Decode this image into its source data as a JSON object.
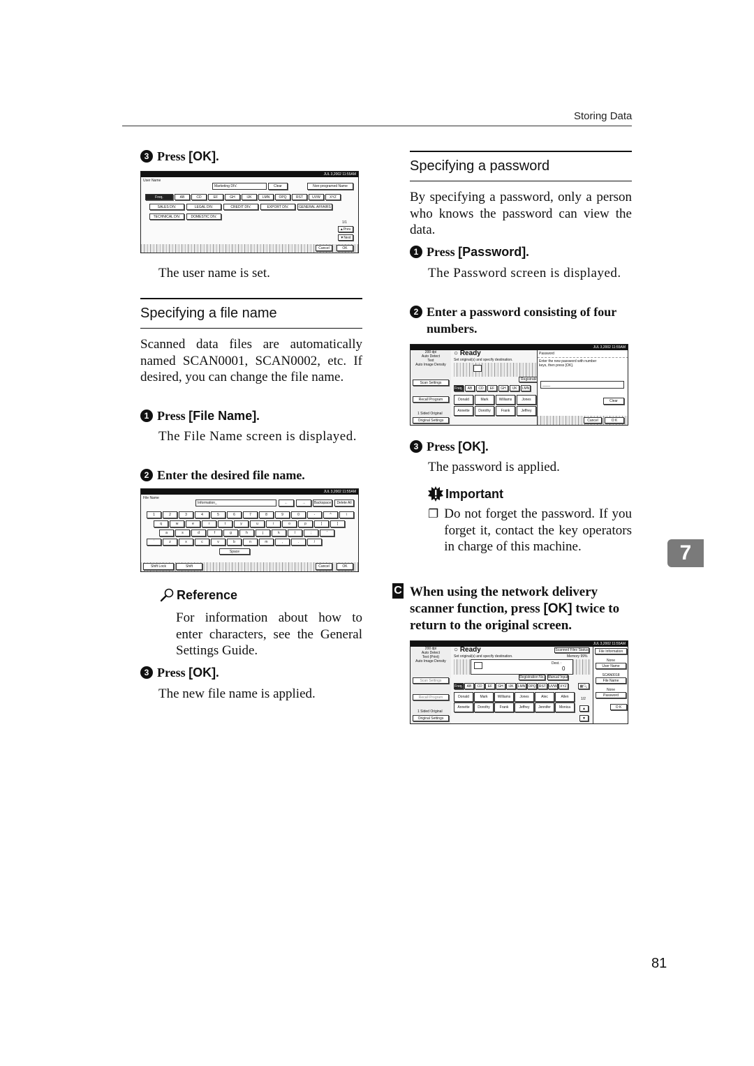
{
  "header": {
    "title": "Storing Data"
  },
  "left": {
    "step3a": {
      "num": "3",
      "prefix": "Press ",
      "key": "[OK]",
      "suffix": "."
    },
    "username_screen": {
      "datetime": "JUL   3,2002 11:55AM",
      "label": "User Name",
      "value": "Marketing DIV.",
      "clear": "Clear",
      "nonprog": "Non-programed Name",
      "tabs": [
        "Freq.",
        "AB",
        "CD",
        "EF",
        "GH",
        "IJK",
        "LMN",
        "OPQ",
        "RST",
        "UVW",
        "XYZ"
      ],
      "entries": [
        "SALES DIV.",
        "LEGAL DIV.",
        "CREDIT DIV.",
        "EXPORT DIV.",
        "GENERAL AFFAIRS",
        "TECHNICAL DIV.",
        "DOMESTIC DIV."
      ],
      "page": "1/1",
      "prev": "▲Prev.",
      "next": "▼Next",
      "cancel": "Cancel",
      "ok": "OK"
    },
    "username_result": "The user name is set.",
    "section_title": "Specifying a file name",
    "intro": "Scanned data files are automatically named SCAN0001, SCAN0002, etc. If desired, you can change the file name.",
    "step1": {
      "num": "1",
      "prefix": "Press ",
      "key": "[File Name]",
      "suffix": "."
    },
    "step1_result": "The File Name screen is displayed.",
    "step2": {
      "num": "2",
      "text": "Enter the desired file name."
    },
    "filename_screen": {
      "datetime": "JUL   3,2002 11:55AM",
      "label": "File Name",
      "value": "Information_",
      "left_arrow": "←",
      "right_arrow": "→",
      "backspace": "Backspace",
      "delete_all": "Delete All",
      "row1": [
        "1",
        "2",
        "3",
        "4",
        "5",
        "6",
        "7",
        "8",
        "9",
        "0",
        "-",
        "^",
        "\\"
      ],
      "row2": [
        "q",
        "w",
        "e",
        "r",
        "t",
        "y",
        "u",
        "i",
        "o",
        "p",
        "[",
        "]"
      ],
      "row3": [
        "a",
        "s",
        "d",
        "f",
        "g",
        "h",
        "j",
        "k",
        "l",
        ";",
        "'"
      ],
      "row4": [
        "`",
        "z",
        "x",
        "c",
        "v",
        "b",
        "n",
        "m",
        ",",
        ".",
        "/"
      ],
      "space": "Space",
      "shift_lock": "Shift Lock",
      "shift": "Shift",
      "cancel": "Cancel",
      "ok": "OK"
    },
    "reference": {
      "title": "Reference",
      "text": "For information about how to enter characters, see the General Settings Guide."
    },
    "step3b": {
      "num": "3",
      "prefix": "Press ",
      "key": "[OK]",
      "suffix": "."
    },
    "step3b_result": "The new file name is applied."
  },
  "right": {
    "section_title": "Specifying a password",
    "intro": "By specifying a password, only a person who knows the password can view the data.",
    "step1": {
      "num": "1",
      "prefix": "Press ",
      "key": "[Password]",
      "suffix": "."
    },
    "step1_result": "The Password screen is displayed.",
    "step2": {
      "num": "2",
      "text": "Enter a password consisting of four numbers."
    },
    "password_screen": {
      "datetime": "JUL   3,2002 11:55AM",
      "side": [
        "200 dpi",
        "Auto Detect",
        "Text",
        "Auto Image Density"
      ],
      "scan_settings": "Scan Settings",
      "recall_program": "Recall Program",
      "sided": "1 Sided Original",
      "orig_settings": "Original Settings",
      "ready": "Ready",
      "ready_sub": "Set original(s) and specify destination.",
      "registration": "Registratio",
      "tabs": [
        "Freq.",
        "AB",
        "CD",
        "EF",
        "GH",
        "IJK",
        "LMN"
      ],
      "names": [
        "Donald",
        "Mark",
        "Williams",
        "Jones",
        "Annette",
        "Dorothy",
        "Frank",
        "Jeffrey"
      ],
      "dialog_title": "Password",
      "dialog_text": "Enter the new password with number keys, then press [OK].",
      "input_value": "____",
      "clear": "Clear",
      "cancel": "Cancel",
      "ok": "O K"
    },
    "step3": {
      "num": "3",
      "prefix": "Press ",
      "key": "[OK]",
      "suffix": "."
    },
    "step3_result": "The password is applied.",
    "important": {
      "title": "Important",
      "text": "Do not forget the password. If you forget it, contact the key operators in charge of this machine."
    },
    "stepC": {
      "num": "C",
      "text_a": "When using the network delivery scanner function, press ",
      "key": "[OK]",
      "text_b": " twice to return to the original screen."
    },
    "final_screen": {
      "datetime": "JUL   3,2002 11:55AM",
      "side": [
        "200 dpi",
        "Auto Detect",
        "Text (Print)",
        "Auto Image Density"
      ],
      "scan_settings": "Scan Settings",
      "recall_program": "Recall Program",
      "sided": "1 Sided Original",
      "orig_settings": "Original Settings",
      "ready": "Ready",
      "ready_sub": "Set original(s) and specify destination.",
      "scanned_status": "Scanned Files Status",
      "memory": "Memory 99%",
      "dest": "Dest. :",
      "dest_count": "0",
      "reg_no": "Registration No.",
      "manual_input": "Manual Input",
      "tabs": [
        "Freq.",
        "AB",
        "CD",
        "EF",
        "GH",
        "IJK",
        "LMN",
        "OPQ",
        "RST",
        "UVW",
        "XYZ"
      ],
      "names": [
        "Donald",
        "Mark",
        "Williams",
        "Jones",
        "Alec",
        "Allen",
        "Annette",
        "Dorothy",
        "Frank",
        "Jeffrey",
        "Jennifer",
        "Monica"
      ],
      "page": "1/2",
      "file_info": "File Information",
      "none1": "None",
      "user_name": "User Name",
      "scan_id": "SCAN0018",
      "file_name": "File Name",
      "none2": "None",
      "password": "Password",
      "ok": "O K"
    }
  },
  "chapter_tab": "7",
  "page_number": "81"
}
